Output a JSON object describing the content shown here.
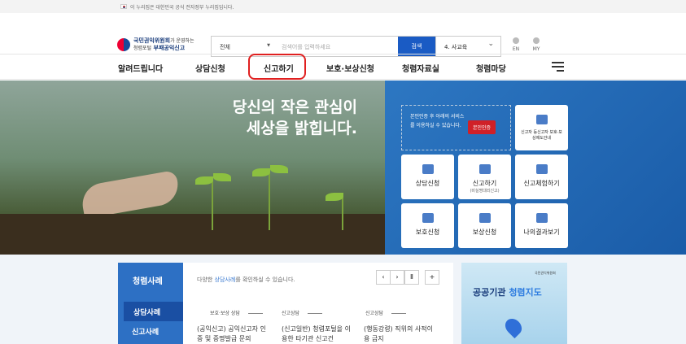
{
  "topbar": {
    "notice": "이 누리집은 대한민국 공식 전자정부 누리집입니다."
  },
  "logo": {
    "line1": "국민권익위원회",
    "line1_suffix": "가 운영하는",
    "line2_sub": "청렴포털",
    "line2": "부패공익신고"
  },
  "search": {
    "category": "전체",
    "placeholder": "검색어를 입력하세요",
    "button": "검색",
    "dropdown": "4. 사교육"
  },
  "util": {
    "en": "EN",
    "my": "MY"
  },
  "gnb": [
    "알려드립니다",
    "상담신청",
    "신고하기",
    "보호·보상신청",
    "청렴자료실",
    "청렴마당"
  ],
  "hero": {
    "line1": "당신의 작은 관심이",
    "line2": "세상을 밝힙니다."
  },
  "cert": {
    "text": "본인인증 후 아래의 서비스를 이용하실 수 있습니다.",
    "button": "본인인증"
  },
  "tiles": [
    {
      "label": "신고자 등신고자 보호·보상제도안내",
      "sub": ""
    },
    {
      "label": "상담신청",
      "sub": ""
    },
    {
      "label": "신고하기",
      "sub": "(비실명대리신고)"
    },
    {
      "label": "신고체험하기",
      "sub": ""
    },
    {
      "label": "보호신청",
      "sub": ""
    },
    {
      "label": "보상신청",
      "sub": ""
    },
    {
      "label": "나의결과보기",
      "sub": ""
    }
  ],
  "cases": {
    "title": "청렴사례",
    "tab_active": "상담사례",
    "tab2": "신고사례",
    "desc_pre": "다양한 ",
    "desc_hl": "상담사례",
    "desc_post": "를 확인하실 수 있습니다.",
    "controls": [
      "‹",
      "›",
      "Ⅱ",
      "+"
    ],
    "items": [
      {
        "category": "보호·보상 상담",
        "text": "(공익신고) 공익신고자 인증 및 증명발급 문의"
      },
      {
        "category": "신고상담",
        "text": "(신고일반) 청렴포털을 이용한 타기관 신고건"
      },
      {
        "category": "신고상담",
        "text": "(행동강령) 직위의 사적이용 금지"
      }
    ]
  },
  "banner": {
    "org": "국민권익위원회",
    "title_a": "공공기관 ",
    "title_b": "청렴지도"
  }
}
